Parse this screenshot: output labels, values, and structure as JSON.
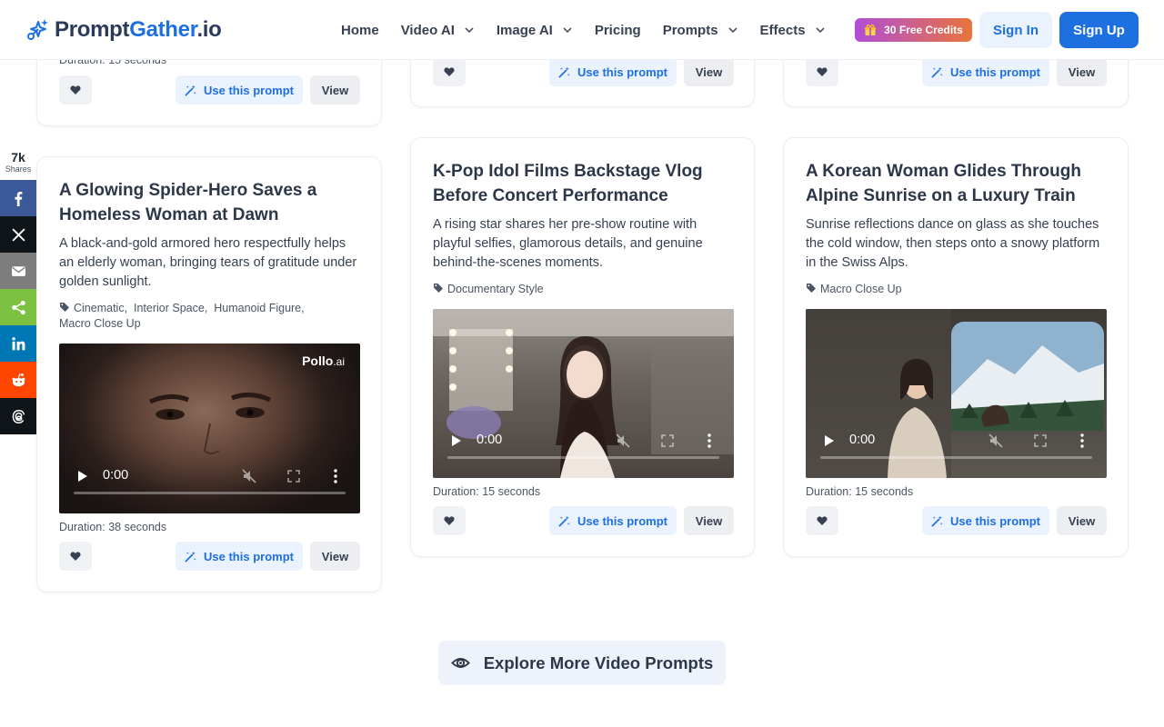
{
  "brand": {
    "name_part1": "Prompt",
    "name_part2": "Gather",
    "name_part3": ".io"
  },
  "nav": {
    "items": [
      {
        "label": "Home",
        "has_dropdown": false
      },
      {
        "label": "Video AI",
        "has_dropdown": true
      },
      {
        "label": "Image AI",
        "has_dropdown": true
      },
      {
        "label": "Pricing",
        "has_dropdown": false
      },
      {
        "label": "Prompts",
        "has_dropdown": true
      },
      {
        "label": "Effects",
        "has_dropdown": true
      }
    ],
    "credits_label": "30 Free Credits",
    "signin_label": "Sign In",
    "signup_label": "Sign Up"
  },
  "share": {
    "count": "7k",
    "label": "Shares",
    "buttons": [
      {
        "icon": "facebook-icon",
        "color": "#3b5998"
      },
      {
        "icon": "x-icon",
        "color": "#0f1419"
      },
      {
        "icon": "email-icon",
        "color": "#7d7d7d"
      },
      {
        "icon": "share-icon",
        "color": "#7cc142"
      },
      {
        "icon": "linkedin-icon",
        "color": "#0077b5"
      },
      {
        "icon": "reddit-icon",
        "color": "#ff4500"
      },
      {
        "icon": "threads-icon",
        "color": "#0f1419"
      }
    ]
  },
  "common": {
    "use_prompt_label": "Use this prompt",
    "view_label": "View",
    "video_time": "0:00"
  },
  "top_cards": [
    {
      "duration": "Duration: 15 seconds"
    },
    {},
    {}
  ],
  "cards": [
    {
      "title": "A Glowing Spider-Hero Saves a Homeless Woman at Dawn",
      "description": "A black-and-gold armored hero respectfully helps an elderly woman, bringing tears of gratitude under golden sunlight.",
      "tags": [
        "Cinematic",
        "Interior Space",
        "Humanoid Figure",
        "Macro Close Up"
      ],
      "watermark": "Pollo",
      "watermark_suffix": ".ai",
      "duration": "Duration: 38 seconds"
    },
    {
      "title": "K-Pop Idol Films Backstage Vlog Before Concert Performance",
      "description": "A rising star shares her pre-show routine with playful selfies, glamorous details, and genuine behind-the-scenes moments.",
      "tags": [
        "Documentary Style"
      ],
      "duration": "Duration: 15 seconds"
    },
    {
      "title": "A Korean Woman Glides Through Alpine Sunrise on a Luxury Train",
      "description": "Sunrise reflections dance on glass as she touches the cold window, then steps onto a snowy platform in the Swiss Alps.",
      "tags": [
        "Macro Close Up"
      ],
      "duration": "Duration: 15 seconds"
    }
  ],
  "explore_label": "Explore More Video Prompts"
}
